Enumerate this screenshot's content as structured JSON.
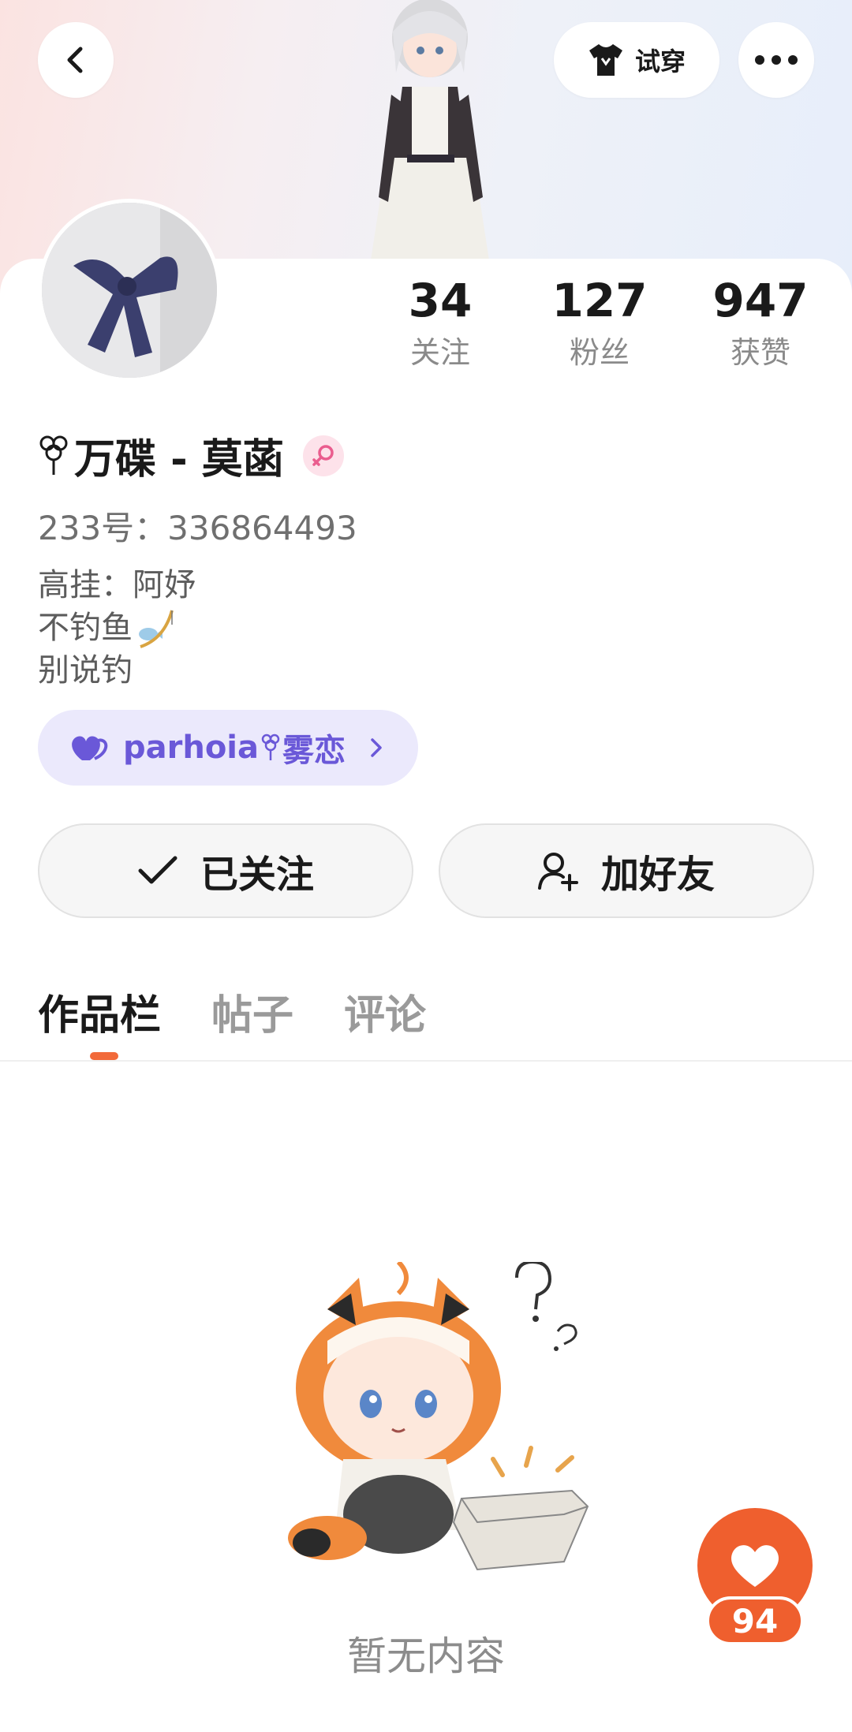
{
  "header": {
    "try_on_label": "试穿"
  },
  "stats": [
    {
      "value": "34",
      "label": "关注"
    },
    {
      "value": "127",
      "label": "粉丝"
    },
    {
      "value": "947",
      "label": "获赞"
    }
  ],
  "profile": {
    "nickname": "万碟 - 莫菡",
    "uid": "233号：336864493",
    "bio_lines": [
      "高挂：阿妤",
      "不钓鱼",
      "别说钓"
    ]
  },
  "guild": {
    "name": "parhoia",
    "suffix": "雾恋"
  },
  "actions": {
    "follow_label": "已关注",
    "add_friend_label": "加好友"
  },
  "tabs": [
    {
      "label": "作品栏",
      "active": true
    },
    {
      "label": "帖子",
      "active": false
    },
    {
      "label": "评论",
      "active": false
    }
  ],
  "empty_state": {
    "text": "暂无内容"
  },
  "like": {
    "count": "94"
  },
  "colors": {
    "accent": "#ef5f2e",
    "guild_text": "#6a58d8",
    "guild_bg": "#ebe9fc"
  }
}
